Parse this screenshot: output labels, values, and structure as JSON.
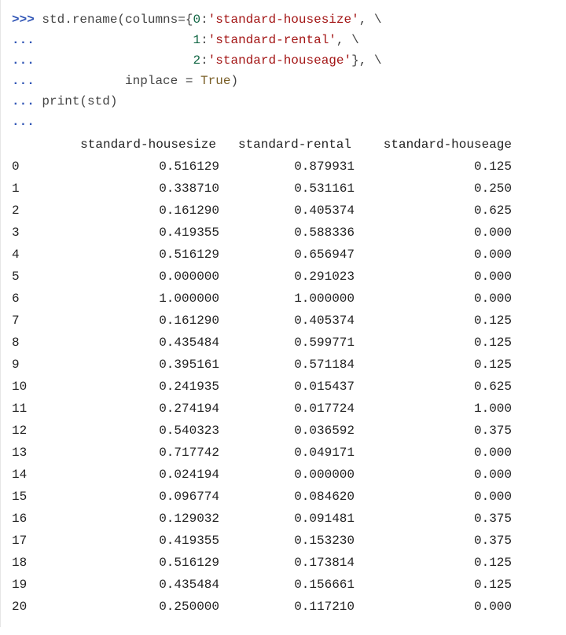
{
  "prompts": {
    "primary": ">>>",
    "continuation": "..."
  },
  "code": {
    "l1a": " std.rename(columns={",
    "l1_key": "0",
    "l1_colon": ":",
    "l1_str": "'standard-housesize'",
    "l1_tail": ", \\",
    "l2_pad": "                     ",
    "l2_key": "1",
    "l2_str": "'standard-rental'",
    "l3_key": "2",
    "l3_str": "'standard-houseage'",
    "l3_tail": "}, \\",
    "l4_pad": "            inplace = ",
    "l4_bool": "True",
    "l4_tail": ")",
    "l5": " print(std)"
  },
  "table": {
    "headers": {
      "idx": "",
      "c1": "standard-housesize",
      "c2": "standard-rental",
      "c3": "standard-houseage"
    },
    "rows": [
      {
        "i": "0",
        "a": "0.516129",
        "b": "0.879931",
        "c": "0.125"
      },
      {
        "i": "1",
        "a": "0.338710",
        "b": "0.531161",
        "c": "0.250"
      },
      {
        "i": "2",
        "a": "0.161290",
        "b": "0.405374",
        "c": "0.625"
      },
      {
        "i": "3",
        "a": "0.419355",
        "b": "0.588336",
        "c": "0.000"
      },
      {
        "i": "4",
        "a": "0.516129",
        "b": "0.656947",
        "c": "0.000"
      },
      {
        "i": "5",
        "a": "0.000000",
        "b": "0.291023",
        "c": "0.000"
      },
      {
        "i": "6",
        "a": "1.000000",
        "b": "1.000000",
        "c": "0.000"
      },
      {
        "i": "7",
        "a": "0.161290",
        "b": "0.405374",
        "c": "0.125"
      },
      {
        "i": "8",
        "a": "0.435484",
        "b": "0.599771",
        "c": "0.125"
      },
      {
        "i": "9",
        "a": "0.395161",
        "b": "0.571184",
        "c": "0.125"
      },
      {
        "i": "10",
        "a": "0.241935",
        "b": "0.015437",
        "c": "0.625"
      },
      {
        "i": "11",
        "a": "0.274194",
        "b": "0.017724",
        "c": "1.000"
      },
      {
        "i": "12",
        "a": "0.540323",
        "b": "0.036592",
        "c": "0.375"
      },
      {
        "i": "13",
        "a": "0.717742",
        "b": "0.049171",
        "c": "0.000"
      },
      {
        "i": "14",
        "a": "0.024194",
        "b": "0.000000",
        "c": "0.000"
      },
      {
        "i": "15",
        "a": "0.096774",
        "b": "0.084620",
        "c": "0.000"
      },
      {
        "i": "16",
        "a": "0.129032",
        "b": "0.091481",
        "c": "0.375"
      },
      {
        "i": "17",
        "a": "0.419355",
        "b": "0.153230",
        "c": "0.375"
      },
      {
        "i": "18",
        "a": "0.516129",
        "b": "0.173814",
        "c": "0.125"
      },
      {
        "i": "19",
        "a": "0.435484",
        "b": "0.156661",
        "c": "0.125"
      },
      {
        "i": "20",
        "a": "0.250000",
        "b": "0.117210",
        "c": "0.000"
      }
    ]
  }
}
